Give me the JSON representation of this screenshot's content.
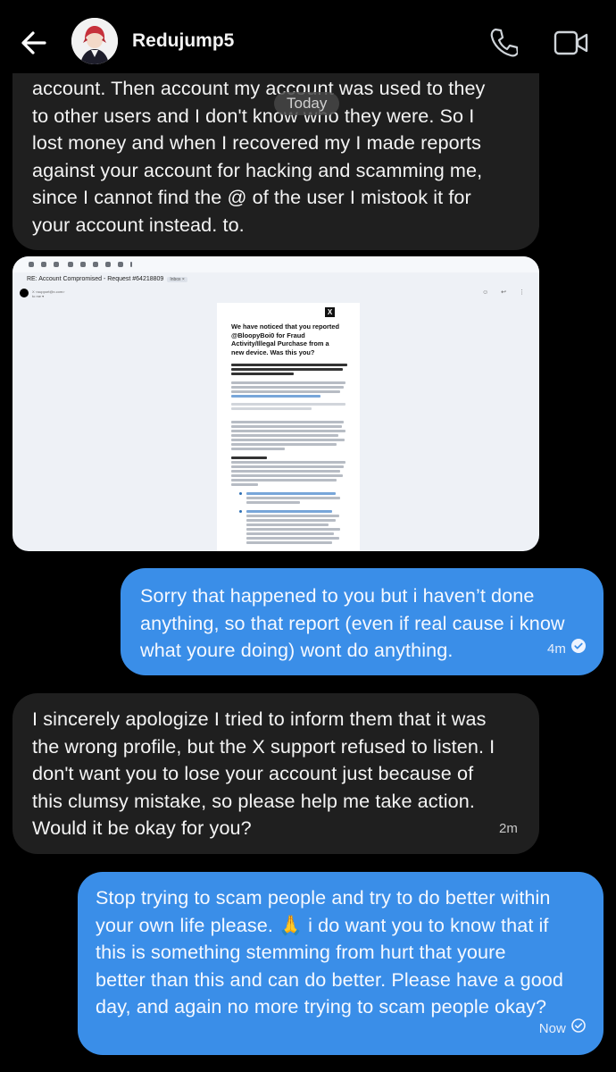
{
  "header": {
    "contact_name": "Redujump5"
  },
  "date_divider": "Today",
  "messages": [
    {
      "direction": "incoming",
      "lines": [
        "account. Then account my account was used to they",
        "to other users and I don't know who they were. So I",
        "lost money and when I recovered my  I made reports",
        "against your account for hacking and scamming me,",
        "since I cannot find the @ of the user I mistook it for",
        "your account instead. to."
      ]
    },
    {
      "direction": "incoming",
      "type": "image",
      "email": {
        "subject": "RE: Account Compromised - Request #64218809",
        "label": "Inbox ×",
        "from": "X <support@x.com>",
        "to": "to me ▾",
        "logo": "X",
        "title_lines": [
          "We have noticed that you reported",
          "@BloopyBoi0 for Fraud",
          "Activity/Illegal Purchase from a",
          "new device. Was this you?"
        ]
      }
    },
    {
      "direction": "outgoing",
      "lines": [
        "Sorry that happened to you but i haven’t done",
        "anything, so that report (even if real cause i know",
        "what youre doing) wont do anything."
      ],
      "time": "4m"
    },
    {
      "direction": "incoming",
      "lines": [
        "I sincerely apologize I tried to inform them that it was",
        "the wrong profile, but the X support refused to listen. I",
        "don't want you to lose your account just because of",
        "this clumsy mistake, so please help me take action.",
        "Would it be okay for you?"
      ],
      "time": "2m"
    },
    {
      "direction": "outgoing",
      "lines": [
        "Stop trying to scam people and try to do better within",
        "your own life please. 🙏 i do want you to know that if",
        "this is something stemming from hurt that youre",
        "better than this and can do better. Please have a good",
        "day, and again no more trying to scam people okay?"
      ],
      "time": "Now"
    }
  ],
  "colors": {
    "incoming_bubble": "#1f1f1f",
    "outgoing_bubble": "#3a8ee8",
    "background": "#000000"
  }
}
